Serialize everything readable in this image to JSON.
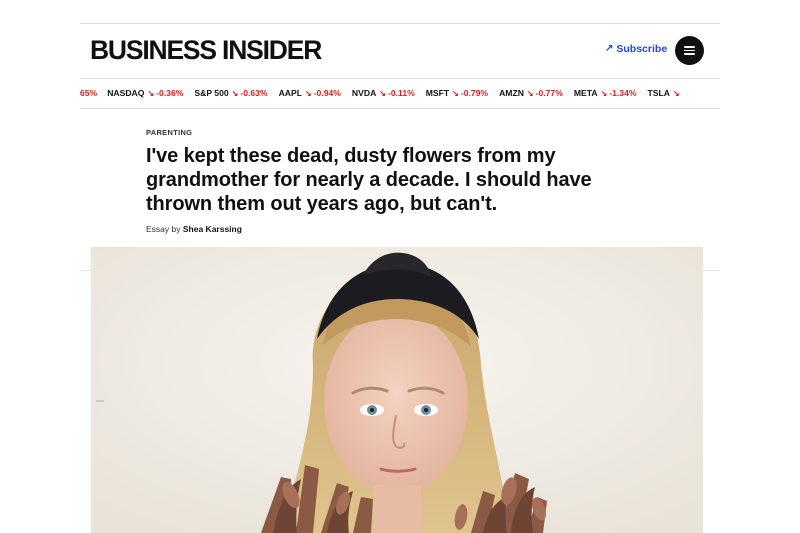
{
  "header": {
    "logo_text": "BUSINESS INSIDER",
    "subscribe_label": "Subscribe",
    "subscribe_icon": "arrow-up-right-icon",
    "menu_icon": "hamburger-menu-icon",
    "accent_color": "#1f47d8"
  },
  "ticker": {
    "leading_change": "65%",
    "items": [
      {
        "symbol": "NASDAQ",
        "change": "-0.36%"
      },
      {
        "symbol": "S&P 500",
        "change": "-0.63%"
      },
      {
        "symbol": "AAPL",
        "change": "-0.94%"
      },
      {
        "symbol": "NVDA",
        "change": "-0.11%"
      },
      {
        "symbol": "MSFT",
        "change": "-0.79%"
      },
      {
        "symbol": "AMZN",
        "change": "-0.77%"
      },
      {
        "symbol": "META",
        "change": "-1.34%"
      },
      {
        "symbol": "TSLA",
        "change": ""
      }
    ],
    "down_color": "#e31a1a"
  },
  "article": {
    "section": "PARENTING",
    "headline": "I've kept these dead, dusty flowers from my grandmother for nearly a decade. I should have thrown them out years ago, but can't.",
    "byline_prefix": "Essay by",
    "author": "Shea Karssing"
  }
}
